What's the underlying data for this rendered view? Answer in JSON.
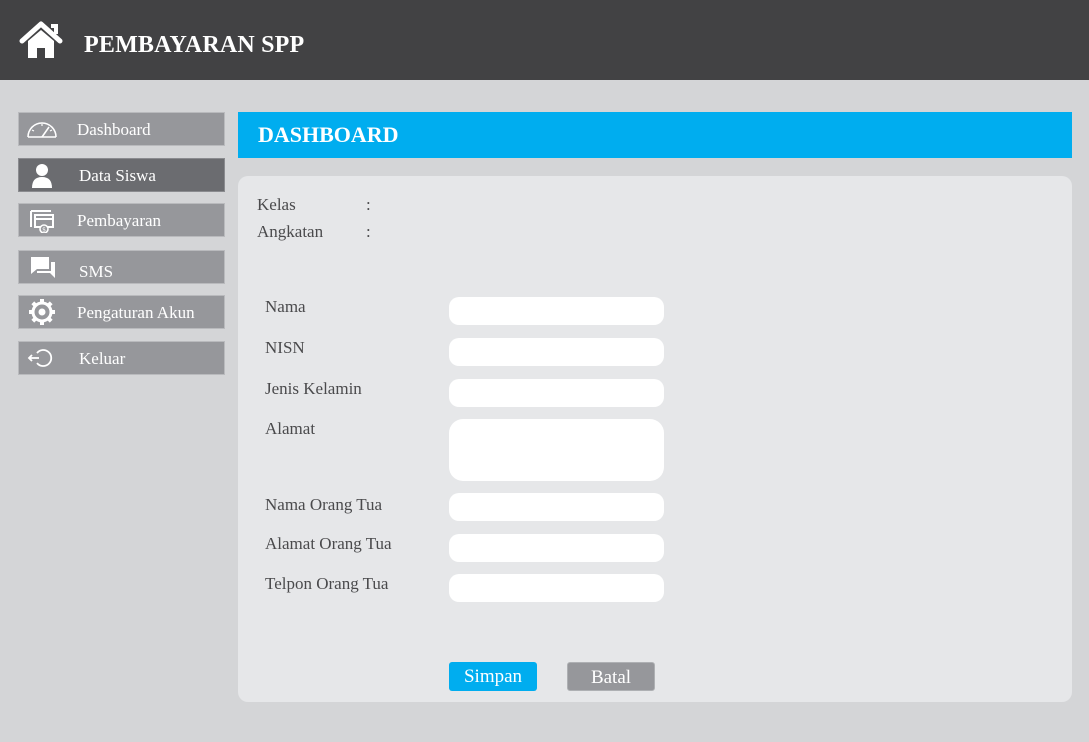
{
  "app": {
    "title": "PEMBAYARAN SPP",
    "icon": "home-icon"
  },
  "sidebar": {
    "items": [
      {
        "label": "Dashboard",
        "icon": "speedometer-icon",
        "active": false
      },
      {
        "label": "Data Siswa",
        "icon": "user-icon",
        "active": true
      },
      {
        "label": "Pembayaran",
        "icon": "payment-icon",
        "active": false
      },
      {
        "label": "SMS",
        "icon": "chat-icon",
        "active": false
      },
      {
        "label": "Pengaturan Akun",
        "icon": "gear-icon",
        "active": false
      },
      {
        "label": "Keluar",
        "icon": "logout-icon",
        "active": false
      }
    ]
  },
  "main": {
    "header_title": "DASHBOARD",
    "info": {
      "kelas_label": "Kelas",
      "kelas_colon": ":",
      "angkatan_label": "Angkatan",
      "angkatan_colon": ":"
    },
    "form": {
      "fields": [
        {
          "label": "Nama",
          "value": ""
        },
        {
          "label": "NISN",
          "value": ""
        },
        {
          "label": "Jenis Kelamin",
          "value": ""
        },
        {
          "label": "Alamat",
          "value": ""
        },
        {
          "label": "Nama Orang Tua",
          "value": ""
        },
        {
          "label": "Alamat Orang Tua",
          "value": ""
        },
        {
          "label": "Telpon Orang Tua",
          "value": ""
        }
      ],
      "save_label": "Simpan",
      "cancel_label": "Batal"
    }
  },
  "colors": {
    "topbar": "#424244",
    "accent": "#00adef",
    "sidebar_item": "#96979b",
    "sidebar_active": "#6b6c70",
    "background": "#d4d5d7",
    "panel": "#e6e7e9"
  }
}
